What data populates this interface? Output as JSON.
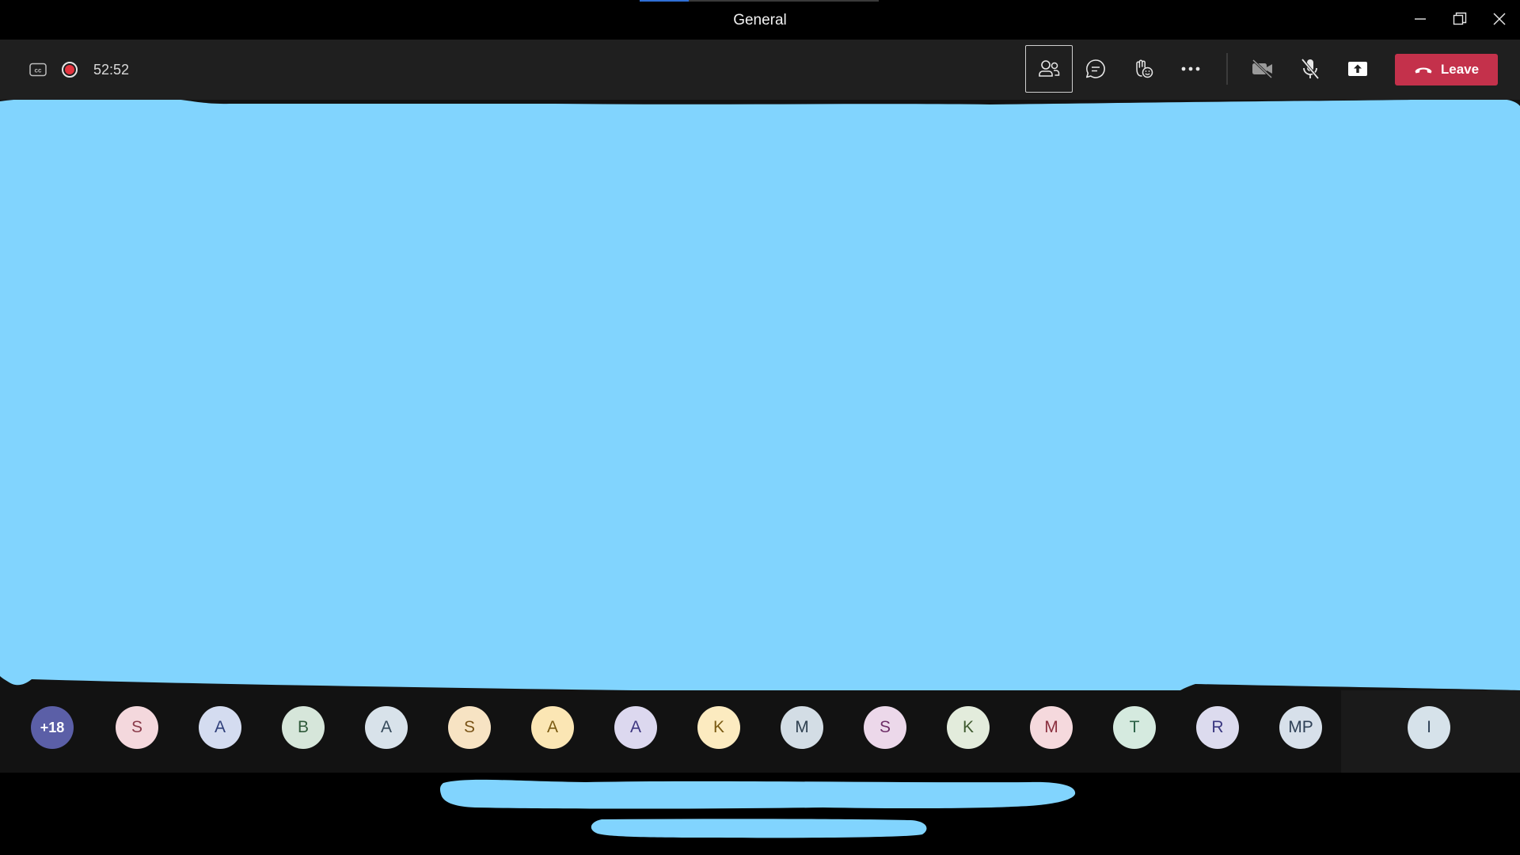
{
  "window": {
    "title": "General"
  },
  "meeting_bar": {
    "timer": "52:52",
    "leave_label": "Leave",
    "buttons": [
      "people",
      "chat",
      "reactions",
      "more-actions",
      "camera-off",
      "mic-off",
      "share-screen"
    ]
  },
  "roster": {
    "overflow_label": "+18",
    "avatars": [
      {
        "initials": "S",
        "bg": "#f4d8dd",
        "fg": "#8a3b4a"
      },
      {
        "initials": "A",
        "bg": "#d4dcf0",
        "fg": "#2f3f7a"
      },
      {
        "initials": "B",
        "bg": "#d6e6da",
        "fg": "#2f5a3a"
      },
      {
        "initials": "A",
        "bg": "#d8e2ea",
        "fg": "#35495a"
      },
      {
        "initials": "S",
        "bg": "#f7e3c3",
        "fg": "#7a5418"
      },
      {
        "initials": "A",
        "bg": "#fbe6b4",
        "fg": "#7a5a12"
      },
      {
        "initials": "A",
        "bg": "#dcd8ef",
        "fg": "#3d3680"
      },
      {
        "initials": "K",
        "bg": "#fcebc0",
        "fg": "#7a5a12"
      },
      {
        "initials": "M",
        "bg": "#d3dde5",
        "fg": "#2f4050"
      },
      {
        "initials": "S",
        "bg": "#ecd8ea",
        "fg": "#6e2f68"
      },
      {
        "initials": "K",
        "bg": "#e3ecdc",
        "fg": "#3f5a2f"
      },
      {
        "initials": "M",
        "bg": "#f5d9dd",
        "fg": "#8a2f3e"
      },
      {
        "initials": "T",
        "bg": "#d5eadf",
        "fg": "#2b6046"
      },
      {
        "initials": "R",
        "bg": "#dcdbee",
        "fg": "#3a3780"
      },
      {
        "initials": "MP",
        "bg": "#d7e0ea",
        "fg": "#2f4157"
      }
    ],
    "self_avatar": {
      "initials": "I",
      "bg": "#d6e2ea",
      "fg": "#2f4157"
    },
    "overflow_bg": "#5b5fa7"
  },
  "colors": {
    "redaction": "#81d4fe",
    "leave": "#c4314b",
    "recording": "#e3343f"
  }
}
